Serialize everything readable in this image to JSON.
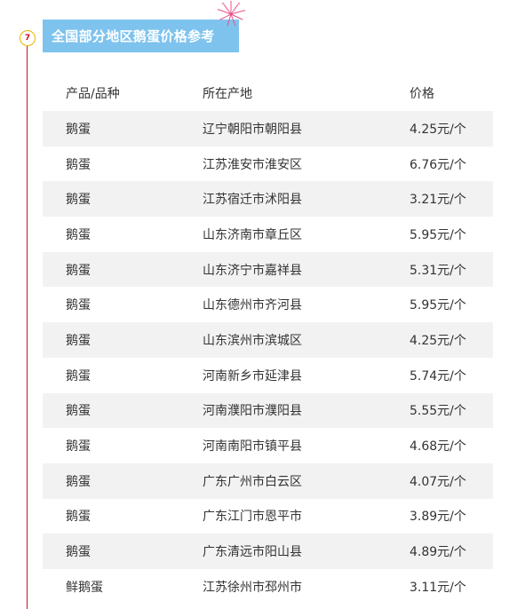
{
  "section": {
    "step_number": "7",
    "title": "全国部分地区鹅蛋价格参考"
  },
  "table": {
    "headers": [
      "产品/品种",
      "所在产地",
      "价格"
    ],
    "rows": [
      [
        "鹅蛋",
        "辽宁朝阳市朝阳县",
        "4.25元/个"
      ],
      [
        "鹅蛋",
        "江苏淮安市淮安区",
        "6.76元/个"
      ],
      [
        "鹅蛋",
        "江苏宿迁市沭阳县",
        "3.21元/个"
      ],
      [
        "鹅蛋",
        "山东济南市章丘区",
        "5.95元/个"
      ],
      [
        "鹅蛋",
        "山东济宁市嘉祥县",
        "5.31元/个"
      ],
      [
        "鹅蛋",
        "山东德州市齐河县",
        "5.95元/个"
      ],
      [
        "鹅蛋",
        "山东滨州市滨城区",
        "4.25元/个"
      ],
      [
        "鹅蛋",
        "河南新乡市延津县",
        "5.74元/个"
      ],
      [
        "鹅蛋",
        "河南濮阳市濮阳县",
        "5.55元/个"
      ],
      [
        "鹅蛋",
        "河南南阳市镇平县",
        "4.68元/个"
      ],
      [
        "鹅蛋",
        "广东广州市白云区",
        "4.07元/个"
      ],
      [
        "鹅蛋",
        "广东江门市恩平市",
        "3.89元/个"
      ],
      [
        "鹅蛋",
        "广东清远市阳山县",
        "4.89元/个"
      ],
      [
        "鲜鹅蛋",
        "江苏徐州市邳州市",
        "3.11元/个"
      ]
    ]
  },
  "colors": {
    "title_bar": "#7ec3ee",
    "timeline": "#c8102e",
    "badge_border": "#e8b400",
    "row_shade": "#f2f2f2"
  }
}
